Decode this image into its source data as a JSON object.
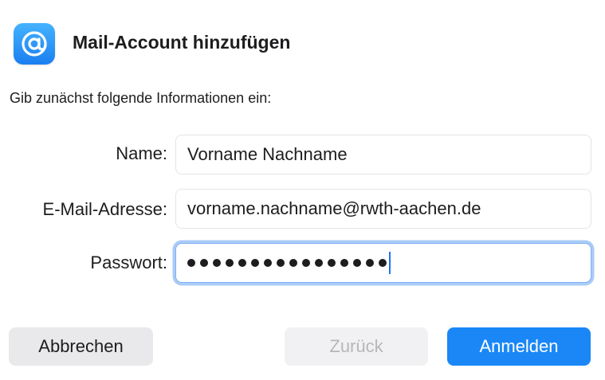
{
  "dialog": {
    "title": "Mail-Account hinzufügen",
    "icon": "at-sign-mail-icon",
    "intro": "Gib zunächst folgende Informationen ein:"
  },
  "form": {
    "name": {
      "label": "Name:",
      "value": "Vorname Nachname"
    },
    "email": {
      "label": "E-Mail-Adresse:",
      "value": "vorname.nachname@rwth-aachen.de"
    },
    "password": {
      "label": "Passwort:",
      "masked_length": 16,
      "focused": true
    }
  },
  "buttons": {
    "cancel": "Abbrechen",
    "back": "Zurück",
    "login": "Anmelden"
  },
  "colors": {
    "accent": "#1b87f6",
    "focus_ring": "#a9cbf7",
    "disabled_text": "#b7b7bb"
  }
}
